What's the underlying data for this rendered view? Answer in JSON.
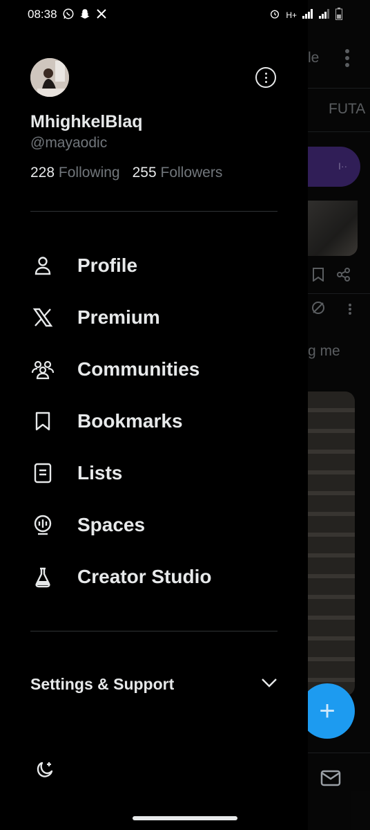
{
  "status_bar": {
    "time": "08:38",
    "left_icons": [
      "whatsapp-icon",
      "snapchat-icon",
      "x-icon"
    ],
    "network": "H+",
    "right_icons": [
      "alarm-icon",
      "signal-icon",
      "signal-icon",
      "battery-icon"
    ]
  },
  "profile": {
    "display_name": "MhighkelBlaq",
    "handle": "@mayaodic",
    "following_count": "228",
    "following_label": "Following",
    "followers_count": "255",
    "followers_label": "Followers"
  },
  "menu": [
    {
      "label": "Profile",
      "icon": "person-icon"
    },
    {
      "label": "Premium",
      "icon": "x-logo-icon"
    },
    {
      "label": "Communities",
      "icon": "communities-icon"
    },
    {
      "label": "Bookmarks",
      "icon": "bookmark-icon"
    },
    {
      "label": "Lists",
      "icon": "list-icon"
    },
    {
      "label": "Spaces",
      "icon": "spaces-icon"
    },
    {
      "label": "Creator Studio",
      "icon": "flask-icon"
    }
  ],
  "settings": {
    "label": "Settings & Support"
  },
  "background_feed": {
    "header_fragment": "le",
    "tab_fragment": "FUTA",
    "post_text_fragment": "g me"
  },
  "colors": {
    "background": "#000000",
    "text_primary": "#e7e9ea",
    "text_secondary": "#71767b",
    "accent": "#1d9bf0",
    "divider": "#2f3336"
  }
}
